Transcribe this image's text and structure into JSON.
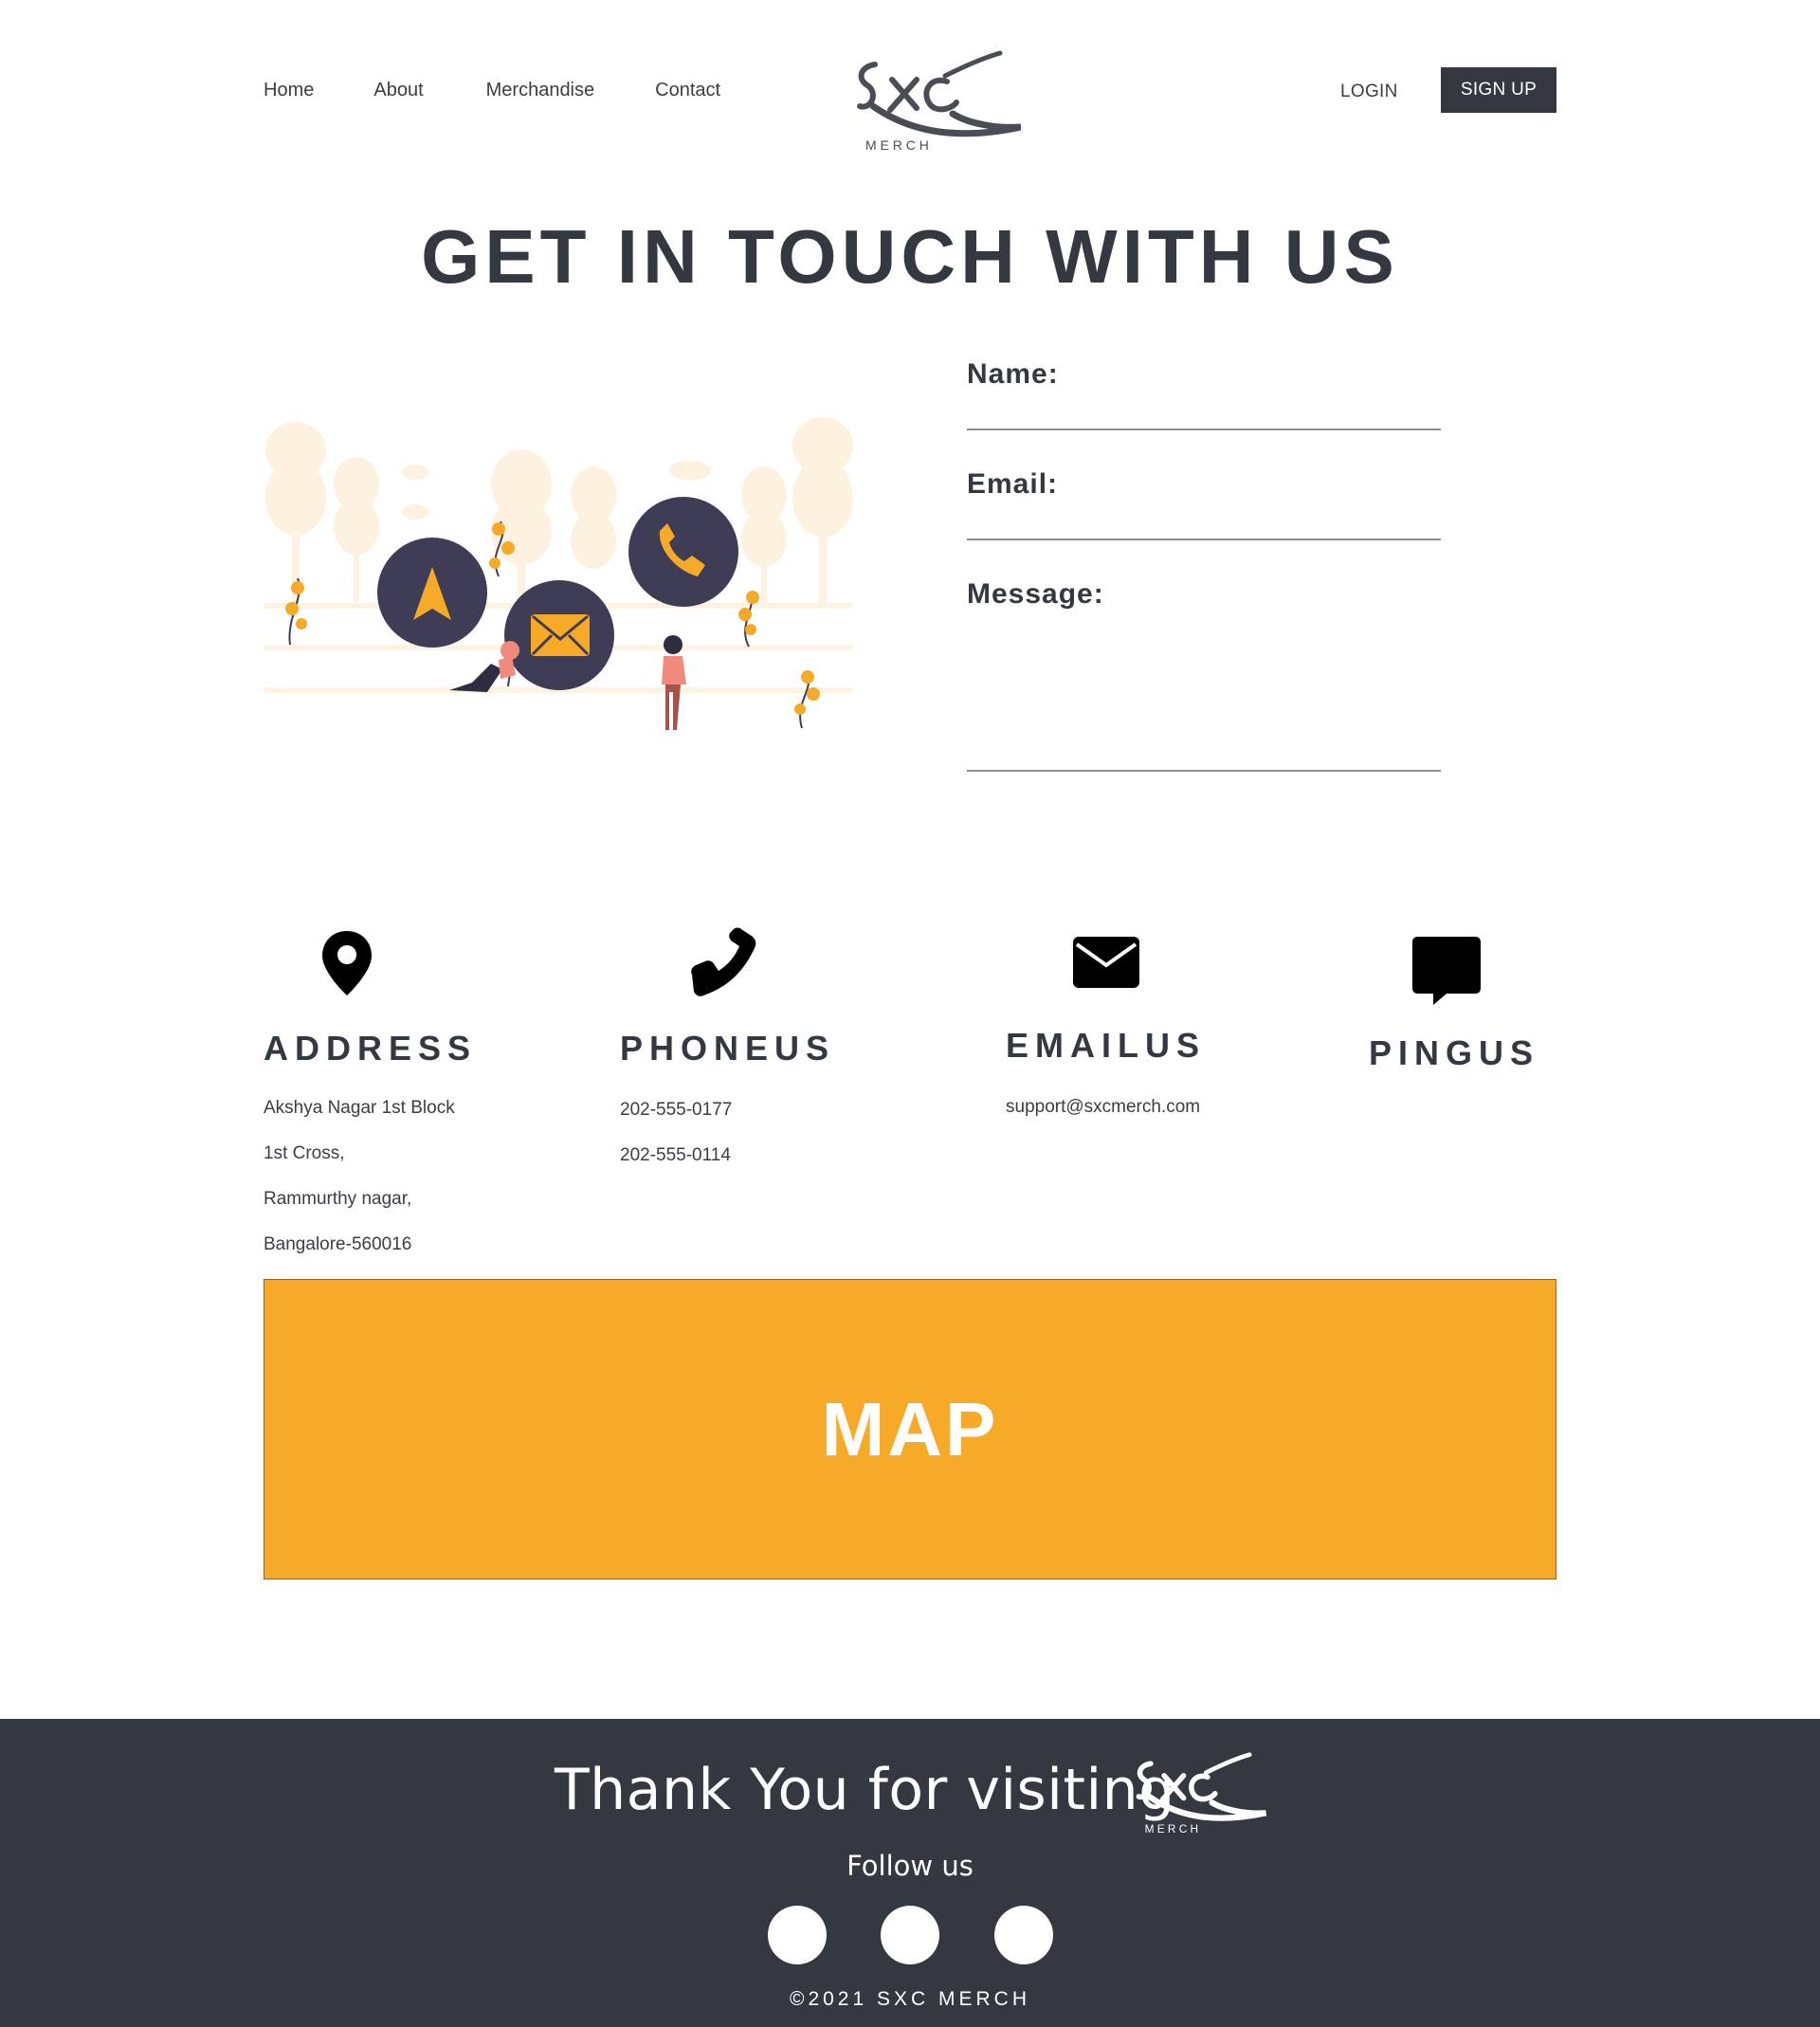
{
  "header": {
    "nav": [
      "Home",
      "About",
      "Merchandise",
      "Contact"
    ],
    "logo": {
      "main": "SXC",
      "sub": "M E R C H"
    },
    "login_label": "LOGIN",
    "signup_label": "SIGN UP"
  },
  "page": {
    "title": "GET IN TOUCH WITH US"
  },
  "illustration": {
    "icons": [
      "navigation-arrow-icon",
      "envelope-icon",
      "phone-icon"
    ],
    "accent_color": "#f7a928",
    "circle_color": "#3f3d56"
  },
  "form": {
    "name_label": "Name:",
    "email_label": "Email:",
    "message_label": "Message:"
  },
  "contact": {
    "address": {
      "icon": "map-pin-icon",
      "title": "ADDRESS",
      "lines": [
        "Akshya Nagar 1st Block",
        "1st Cross,",
        "Rammurthy nagar,",
        "Bangalore-560016"
      ]
    },
    "phone": {
      "icon": "phone-icon",
      "title": "PHONEUS",
      "lines": [
        "202-555-0177",
        "202-555-0114"
      ]
    },
    "email": {
      "icon": "envelope-icon",
      "title": "EMAILUS",
      "lines": [
        "support@sxcmerch.com"
      ]
    },
    "ping": {
      "icon": "chat-bubble-icon",
      "title": "PINGUS"
    }
  },
  "map": {
    "label": "MAP",
    "color": "#f7a928"
  },
  "footer": {
    "thanks": "Thank You for visiting",
    "follow": "Follow us",
    "copyright": "©2021 SXC MERCH",
    "background": "#343841"
  }
}
